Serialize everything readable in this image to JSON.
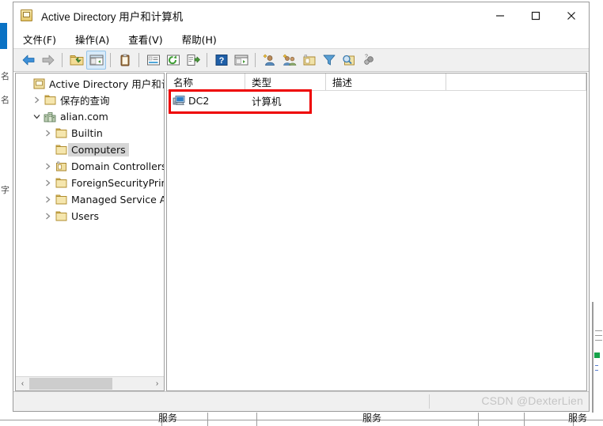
{
  "window": {
    "title": "Active Directory 用户和计算机",
    "icon": "console-book-icon",
    "controls": {
      "minimize": "—",
      "maximize": "□",
      "close": "✕",
      "minimize_name": "minimize-button",
      "maximize_name": "maximize-button",
      "close_name": "close-button"
    }
  },
  "menubar": {
    "items": [
      {
        "label": "文件(F)",
        "name": "menu-file"
      },
      {
        "label": "操作(A)",
        "name": "menu-action"
      },
      {
        "label": "查看(V)",
        "name": "menu-view"
      },
      {
        "label": "帮助(H)",
        "name": "menu-help"
      }
    ]
  },
  "toolbar": {
    "buttons": [
      {
        "icon": "back-arrow-icon",
        "active": false
      },
      {
        "icon": "forward-arrow-icon",
        "active": false
      },
      {
        "icon": "up-folder-icon",
        "active": false
      },
      {
        "icon": "show-hide-tree-icon",
        "active": true
      },
      {
        "icon": "clipboard-icon",
        "active": false
      },
      {
        "icon": "properties-icon",
        "active": false
      },
      {
        "icon": "refresh-icon",
        "active": false
      },
      {
        "icon": "export-list-icon",
        "active": false
      },
      {
        "icon": "help-icon",
        "active": false
      },
      {
        "icon": "show-console-tree-icon",
        "active": false
      },
      {
        "icon": "new-user-icon",
        "active": false
      },
      {
        "icon": "new-group-icon",
        "active": false
      },
      {
        "icon": "new-ou-icon",
        "active": false
      },
      {
        "icon": "filter-icon",
        "active": false
      },
      {
        "icon": "find-icon",
        "active": false
      },
      {
        "icon": "saved-query-icon",
        "active": false
      }
    ]
  },
  "tree": {
    "nodes": [
      {
        "label": "Active Directory 用户和计算机",
        "level": 0,
        "twisty": "none",
        "icon": "console-book-icon",
        "selected": false
      },
      {
        "label": "保存的查询",
        "level": 1,
        "twisty": "collapsed",
        "icon": "folder-icon",
        "selected": false
      },
      {
        "label": "alian.com",
        "level": 1,
        "twisty": "expanded",
        "icon": "domain-icon",
        "selected": false
      },
      {
        "label": "Builtin",
        "level": 2,
        "twisty": "collapsed",
        "icon": "folder-icon",
        "selected": false
      },
      {
        "label": "Computers",
        "level": 2,
        "twisty": "none",
        "icon": "folder-icon",
        "selected": true
      },
      {
        "label": "Domain Controllers",
        "level": 2,
        "twisty": "collapsed",
        "icon": "ou-folder-icon",
        "selected": false
      },
      {
        "label": "ForeignSecurityPrincipals",
        "level": 2,
        "twisty": "collapsed",
        "icon": "folder-icon",
        "selected": false
      },
      {
        "label": "Managed Service Accounts",
        "level": 2,
        "twisty": "collapsed",
        "icon": "folder-icon",
        "selected": false
      },
      {
        "label": "Users",
        "level": 2,
        "twisty": "collapsed",
        "icon": "folder-icon",
        "selected": false
      }
    ],
    "hscroll": {
      "left_arrow": "‹",
      "right_arrow": "›"
    }
  },
  "list": {
    "columns": [
      {
        "label": "名称",
        "name": "column-header-name"
      },
      {
        "label": "类型",
        "name": "column-header-type"
      },
      {
        "label": "描述",
        "name": "column-header-description"
      }
    ],
    "rows": [
      {
        "name": "DC2",
        "type": "计算机",
        "description": "",
        "icon": "computer-icon"
      }
    ]
  },
  "annotation": {
    "color": "#ee0000",
    "name": "red-highlight-box"
  },
  "statusbar": {
    "watermark": "CSDN @DexterLien"
  },
  "background": {
    "ghost_texts": [
      "服务",
      "服务",
      "服务"
    ],
    "accent_color": "#0a72c4"
  }
}
